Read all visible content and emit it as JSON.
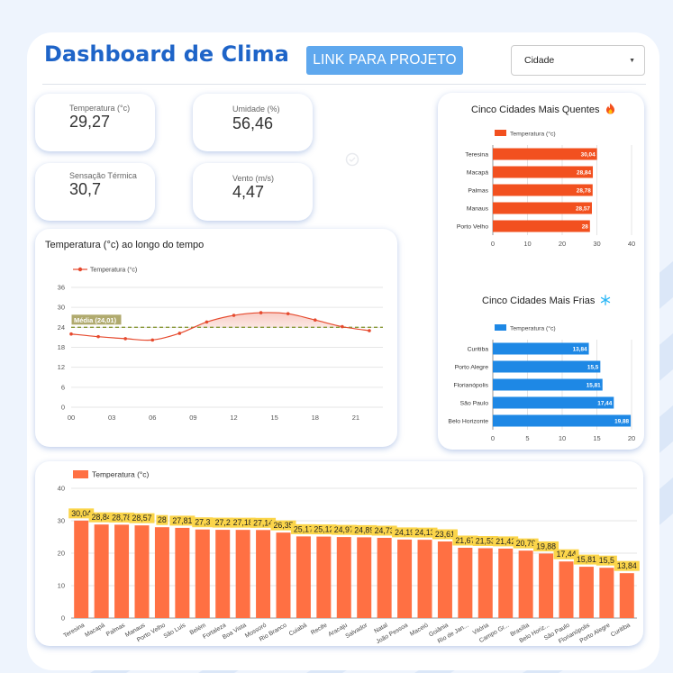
{
  "header": {
    "title": "Dashboard de Clima",
    "link_label": "LINK PARA PROJETO",
    "city_select": {
      "selected": "Cidade"
    }
  },
  "kpis": {
    "temperature": {
      "label": "Temperatura (°c)",
      "value": "29,27"
    },
    "humidity": {
      "label": "Umidade (%)",
      "value": "56,46"
    },
    "feels_like": {
      "label": "Sensação Térmica",
      "value": "30,7"
    },
    "wind": {
      "label": "Vento (m/s)",
      "value": "4,47"
    }
  },
  "colors": {
    "accent": "#1e64c8",
    "hot": "#f2501f",
    "cold": "#1e88e5",
    "bar": "#ff7043",
    "line": "#e64a2e",
    "label_bg": "#fbd54a",
    "avg_line": "#8a9a3a"
  },
  "chart_data": [
    {
      "id": "hottest",
      "type": "bar",
      "orientation": "horizontal",
      "title": "Cinco Cidades Mais Quentes",
      "title_icon": "fire-icon",
      "legend": "Temperatura (°c)",
      "categories": [
        "Teresina",
        "Macapá",
        "Palmas",
        "Manaus",
        "Porto Velho"
      ],
      "values": [
        30.04,
        28.84,
        28.78,
        28.57,
        28
      ],
      "data_labels": [
        "30,04",
        "28,84",
        "28,78",
        "28,57",
        "28"
      ],
      "xlim": [
        0,
        40
      ],
      "xticks": [
        0,
        10,
        20,
        30,
        40
      ]
    },
    {
      "id": "coldest",
      "type": "bar",
      "orientation": "horizontal",
      "title": "Cinco Cidades Mais Frias",
      "title_icon": "snowflake-icon",
      "legend": "Temperatura (°c)",
      "categories": [
        "Curitiba",
        "Porto Alegre",
        "Florianópolis",
        "São Paulo",
        "Belo Horizonte"
      ],
      "values": [
        13.84,
        15.5,
        15.81,
        17.44,
        19.88
      ],
      "data_labels": [
        "13,84",
        "15,5",
        "15,81",
        "17,44",
        "19,88"
      ],
      "xlim": [
        0,
        20
      ],
      "xticks": [
        0,
        5,
        10,
        15,
        20
      ]
    },
    {
      "id": "time_series",
      "type": "line",
      "title": "Temperatura (°c) ao longo do tempo",
      "legend": "Temperatura (°c)",
      "x": [
        0,
        2,
        4,
        6,
        8,
        10,
        12,
        14,
        16,
        18,
        20,
        22
      ],
      "y": [
        22,
        21.2,
        20.6,
        20.2,
        22.2,
        25.6,
        27.6,
        28.4,
        28.1,
        26.2,
        24.2,
        23
      ],
      "xticks": [
        0,
        3,
        6,
        9,
        12,
        15,
        18,
        21
      ],
      "xtick_labels": [
        "00",
        "03",
        "06",
        "09",
        "12",
        "15",
        "18",
        "21"
      ],
      "ylim": [
        0,
        36
      ],
      "yticks": [
        0,
        6,
        12,
        18,
        24,
        30,
        36
      ],
      "average": 24.01,
      "average_label": "Média (24,01)"
    },
    {
      "id": "all_cities",
      "type": "bar",
      "legend": "Temperatura (°c)",
      "categories": [
        "Teresina",
        "Macapá",
        "Palmas",
        "Manaus",
        "Porto Velho",
        "São Luís",
        "Belém",
        "Fortaleza",
        "Boa Vista",
        "Mossoró",
        "Rio Branco",
        "Cuiabá",
        "Recife",
        "Aracaju",
        "Salvador",
        "Natal",
        "João Pessoa",
        "Maceió",
        "Goiânia",
        "Rio de Jan...",
        "Vitória",
        "Campo Gr...",
        "Brasília",
        "Belo Horiz...",
        "São Paulo",
        "Florianópolis",
        "Porto Alegre",
        "Curitiba"
      ],
      "values": [
        30.04,
        28.84,
        28.78,
        28.57,
        28,
        27.81,
        27.3,
        27.2,
        27.18,
        27.14,
        26.35,
        25.17,
        25.12,
        24.97,
        24.89,
        24.73,
        24.19,
        24.13,
        23.61,
        21.67,
        21.53,
        21.42,
        20.79,
        19.88,
        17.44,
        15.81,
        15.5,
        13.84
      ],
      "data_labels": [
        "30,04",
        "28,84",
        "28,78",
        "28,57",
        "28",
        "27,81",
        "27,3",
        "27,2",
        "27,18",
        "27,14",
        "26,35",
        "25,17",
        "25,12",
        "24,97",
        "24,89",
        "24,73",
        "24,19",
        "24,13",
        "23,61",
        "21,67",
        "21,53",
        "21,42",
        "20,79",
        "19,88",
        "17,44",
        "15,81",
        "15,5",
        "13,84"
      ],
      "ylim": [
        0,
        40
      ],
      "yticks": [
        0,
        10,
        20,
        30,
        40
      ]
    }
  ]
}
